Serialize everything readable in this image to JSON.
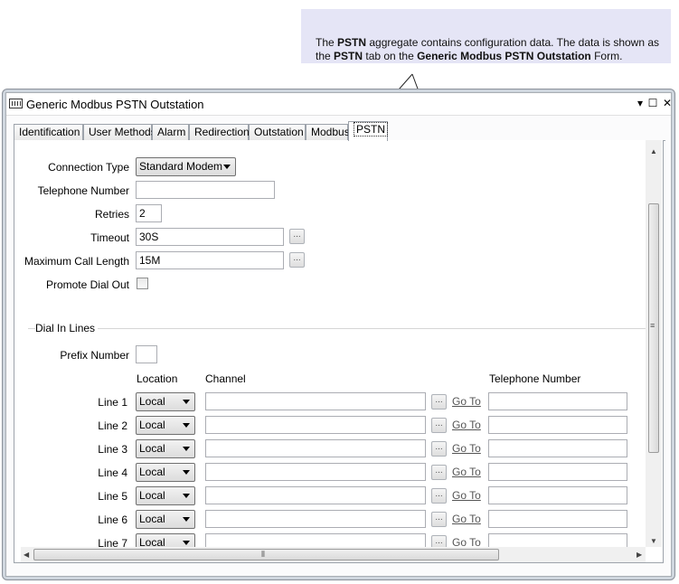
{
  "callout": {
    "p1": "The ",
    "b1": "PSTN",
    "p2": " aggregate contains configuration data. The data is shown as the ",
    "b2": "PSTN",
    "p3": " tab on the ",
    "b3": "Generic Modbus PSTN Outstation",
    "p4": " Form."
  },
  "window": {
    "title": "Generic Modbus PSTN Outstation",
    "controls": {
      "dropdown": "▾",
      "maximize": "☐",
      "close": "✕"
    }
  },
  "tabs": [
    "Identification",
    "User Methods",
    "Alarm",
    "Redirection",
    "Outstation",
    "Modbus",
    "PSTN"
  ],
  "active_tab": "PSTN",
  "form": {
    "connection_type": {
      "label": "Connection Type",
      "value": "Standard Modem"
    },
    "telephone_number": {
      "label": "Telephone Number",
      "value": ""
    },
    "retries": {
      "label": "Retries",
      "value": "2"
    },
    "timeout": {
      "label": "Timeout",
      "value": "30S"
    },
    "max_call_length": {
      "label": "Maximum Call Length",
      "value": "15M"
    },
    "promote_dial_out": {
      "label": "Promote Dial Out",
      "checked": false
    },
    "browse_label": "..."
  },
  "dial_in": {
    "group_label": "Dial In Lines",
    "prefix_label": "Prefix Number",
    "prefix_value": "",
    "headers": {
      "location": "Location",
      "channel": "Channel",
      "telephone": "Telephone Number"
    },
    "goto_label": "Go To",
    "lines": [
      {
        "label": "Line 1",
        "location": "Local",
        "channel": "",
        "telephone": ""
      },
      {
        "label": "Line 2",
        "location": "Local",
        "channel": "",
        "telephone": ""
      },
      {
        "label": "Line 3",
        "location": "Local",
        "channel": "",
        "telephone": ""
      },
      {
        "label": "Line 4",
        "location": "Local",
        "channel": "",
        "telephone": ""
      },
      {
        "label": "Line 5",
        "location": "Local",
        "channel": "",
        "telephone": ""
      },
      {
        "label": "Line 6",
        "location": "Local",
        "channel": "",
        "telephone": ""
      },
      {
        "label": "Line 7",
        "location": "Local",
        "channel": "",
        "telephone": ""
      }
    ]
  },
  "icons": {
    "app": "modbus-outstation-icon",
    "scroll_up": "▲",
    "scroll_down": "▼",
    "scroll_left": "◀",
    "scroll_right": "▶",
    "vgrip": "≡",
    "hgrip": "⦀"
  },
  "colors": {
    "callout_bg": "#e5e5f6",
    "window_frame": "#cfd6de"
  }
}
